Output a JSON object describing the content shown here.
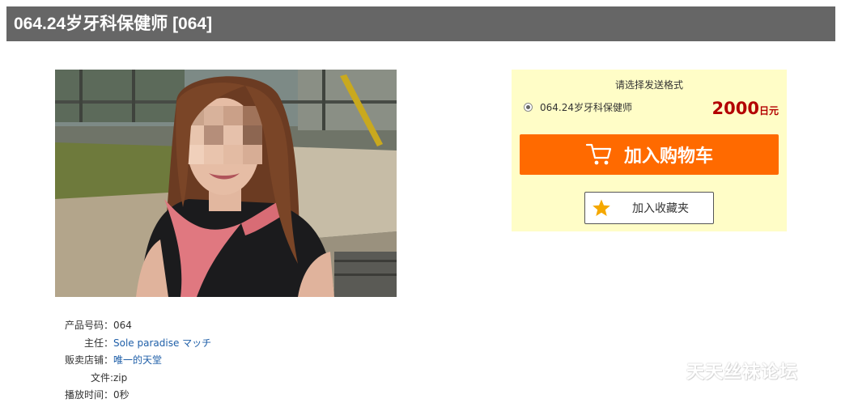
{
  "product": {
    "title": "064.24岁牙科保健师 [064]",
    "image_alt": "woman sitting in a park (face pixelated)"
  },
  "details": {
    "code_label": "产品号码：",
    "code_value": "064",
    "lead_label": "主任：",
    "lead_value": "Sole paradise マッチ",
    "shop_label": "贩卖店铺：",
    "shop_value": "唯一的天堂",
    "file_label": "文件:",
    "file_value": "zip",
    "duration_label": "播放时间：",
    "duration_value": "0秒"
  },
  "purchase": {
    "format_prompt": "请选择发送格式",
    "option_label": "064.24岁牙科保健师",
    "price_number": "2000",
    "price_unit": "日元",
    "cart_label": "加入购物车",
    "favorite_label": "加入收藏夹"
  },
  "watermark": "天天丝袜论坛",
  "colors": {
    "title_bar": "#666666",
    "buy_box_bg": "#fffdc7",
    "cart_button": "#ff6a00",
    "price": "#b30000",
    "link": "#1f5fa8",
    "star": "#f5a800"
  },
  "icons": {
    "cart": "shopping-cart-icon",
    "favorite": "star-icon",
    "radio": "radio-selected"
  }
}
